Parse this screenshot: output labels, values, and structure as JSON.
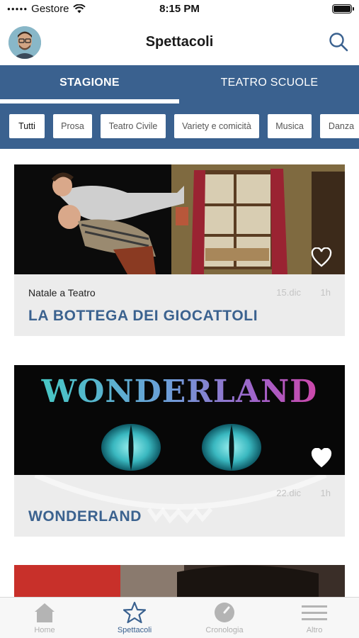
{
  "status_bar": {
    "carrier": "Gestore",
    "time": "8:15 PM"
  },
  "header": {
    "title": "Spettacoli"
  },
  "tabs": [
    {
      "label": "STAGIONE",
      "active": true
    },
    {
      "label": "TEATRO SCUOLE",
      "active": false
    }
  ],
  "filters": [
    "Tutti",
    "Prosa",
    "Teatro Civile",
    "Variety e comicità",
    "Musica",
    "Danza"
  ],
  "cards": [
    {
      "category": "Natale a Teatro",
      "date": "15.dic",
      "duration": "1h",
      "title": "LA BOTTEGA DEI GIOCATTOLI",
      "favorite": false
    },
    {
      "category": "",
      "date": "22.dic",
      "duration": "1h",
      "title": "WONDERLAND",
      "image_text": "WONDERLAND",
      "favorite": true
    }
  ],
  "tabbar": [
    {
      "label": "Home",
      "icon": "home-icon",
      "active": false
    },
    {
      "label": "Spettacoli",
      "icon": "star-icon",
      "active": true
    },
    {
      "label": "Cronologia",
      "icon": "clock-icon",
      "active": false
    },
    {
      "label": "Altro",
      "icon": "menu-icon",
      "active": false
    }
  ],
  "colors": {
    "primary": "#3a618f",
    "title_blue": "#3b628f",
    "info_bg": "#ececec"
  }
}
